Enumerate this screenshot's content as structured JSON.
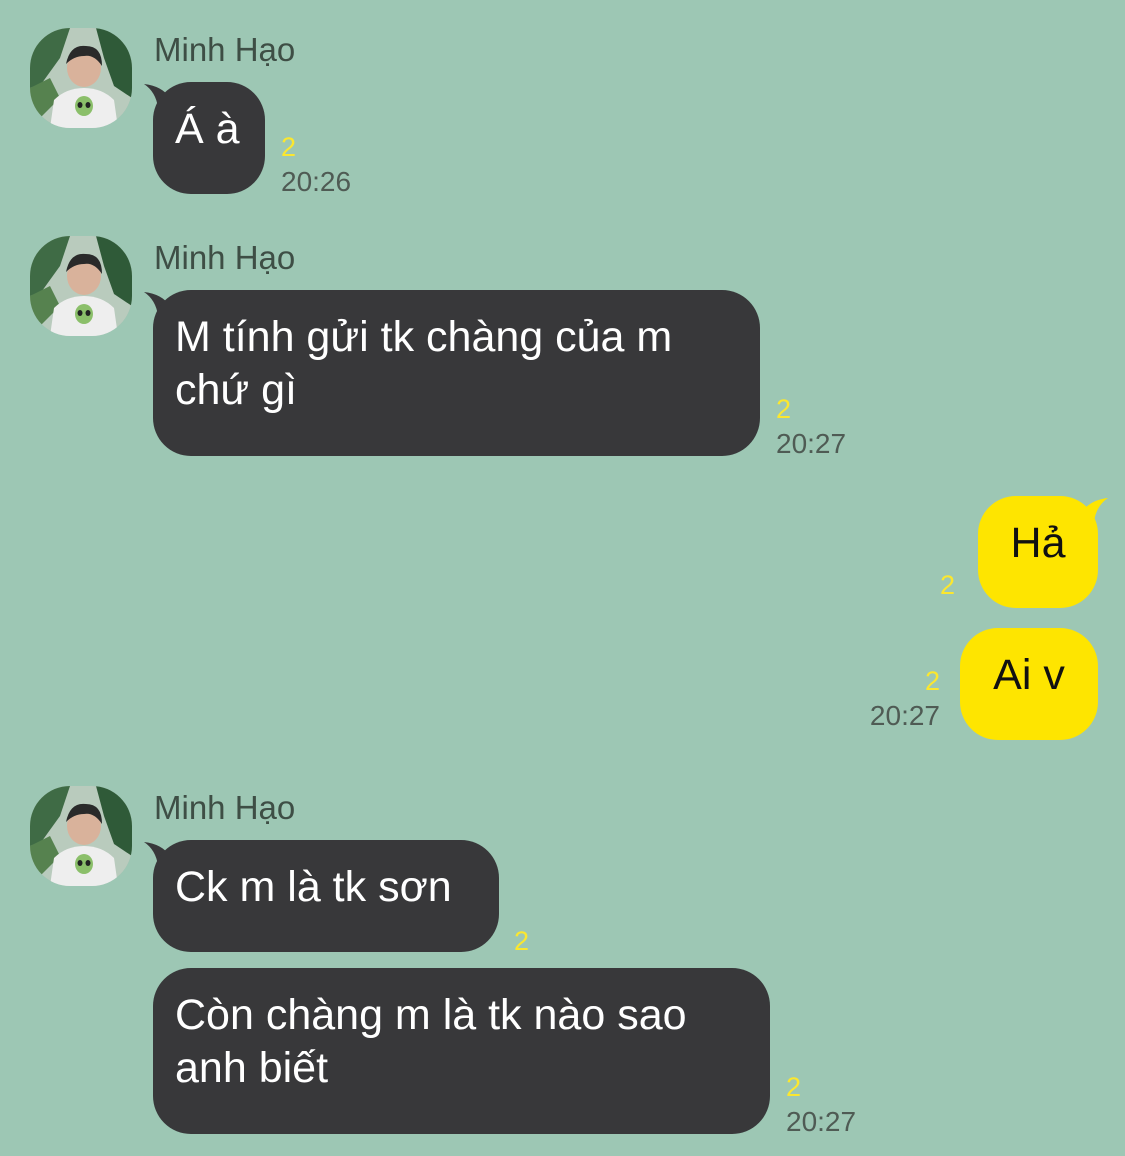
{
  "chat": {
    "sender_name": "Minh Hạo",
    "colors": {
      "background": "#9dc7b4",
      "incoming_bubble": "#38383a",
      "outgoing_bubble": "#fee500",
      "unread_count": "#fbe72f"
    },
    "groups": [
      {
        "sender": "Minh Hạo",
        "messages": [
          {
            "text": "Á à",
            "unread": "2",
            "time": "20:26"
          }
        ]
      },
      {
        "sender": "Minh Hạo",
        "messages": [
          {
            "line1": "M tính gửi tk chàng của m",
            "line2": "chứ gì",
            "unread": "2",
            "time": "20:27"
          }
        ]
      },
      {
        "sender": "me",
        "messages": [
          {
            "text": "Hả",
            "unread": "2"
          },
          {
            "text": "Ai v",
            "unread": "2",
            "time": "20:27"
          }
        ]
      },
      {
        "sender": "Minh Hạo",
        "messages": [
          {
            "text": "Ck m là tk sơn",
            "unread": "2"
          },
          {
            "line1": "Còn chàng m là tk nào sao",
            "line2": "anh biết",
            "unread": "2",
            "time": "20:27"
          }
        ]
      }
    ]
  }
}
